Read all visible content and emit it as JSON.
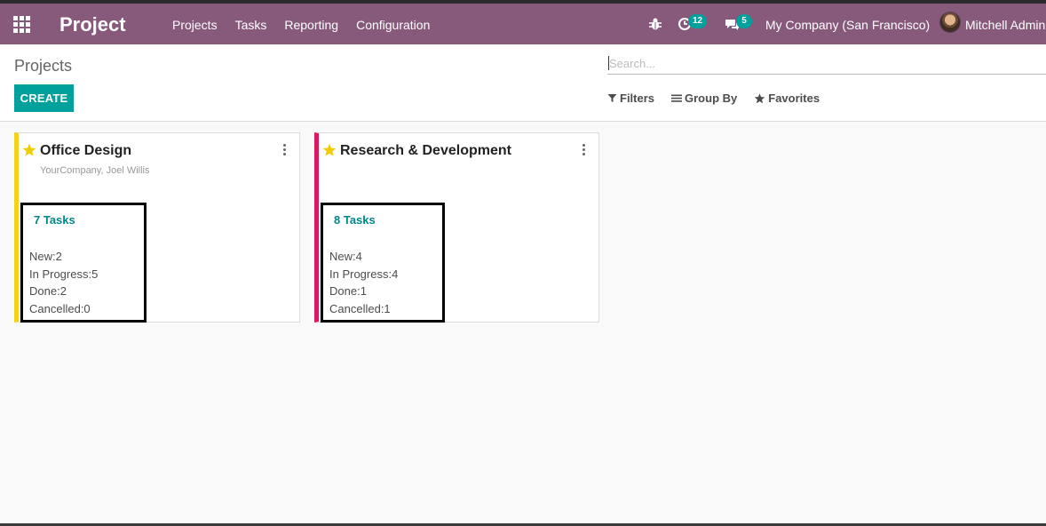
{
  "navbar": {
    "brand": "Project",
    "menu": [
      "Projects",
      "Tasks",
      "Reporting",
      "Configuration"
    ],
    "activity_count": "12",
    "message_count": "5",
    "company": "My Company (San Francisco)",
    "user": "Mitchell Admin (",
    "bg_color": "#875a7b"
  },
  "control": {
    "breadcrumb": "Projects",
    "create_label": "CREATE",
    "search_placeholder": "Search...",
    "filters_label": "Filters",
    "groupby_label": "Group By",
    "favorites_label": "Favorites"
  },
  "projects": [
    {
      "name": "Office Design",
      "subtitle": "YourCompany, Joel Willis",
      "tasks_label": "7 Tasks",
      "stages": [
        "New:2",
        "In Progress:5",
        "Done:2",
        "Cancelled:0"
      ],
      "color": "#f4d11a"
    },
    {
      "name": "Research & Development",
      "subtitle": "",
      "tasks_label": "8 Tasks",
      "stages": [
        "New:4",
        "In Progress:4",
        "Done:1",
        "Cancelled:1"
      ],
      "color": "#d81b60"
    }
  ],
  "accent": "#00a09d"
}
